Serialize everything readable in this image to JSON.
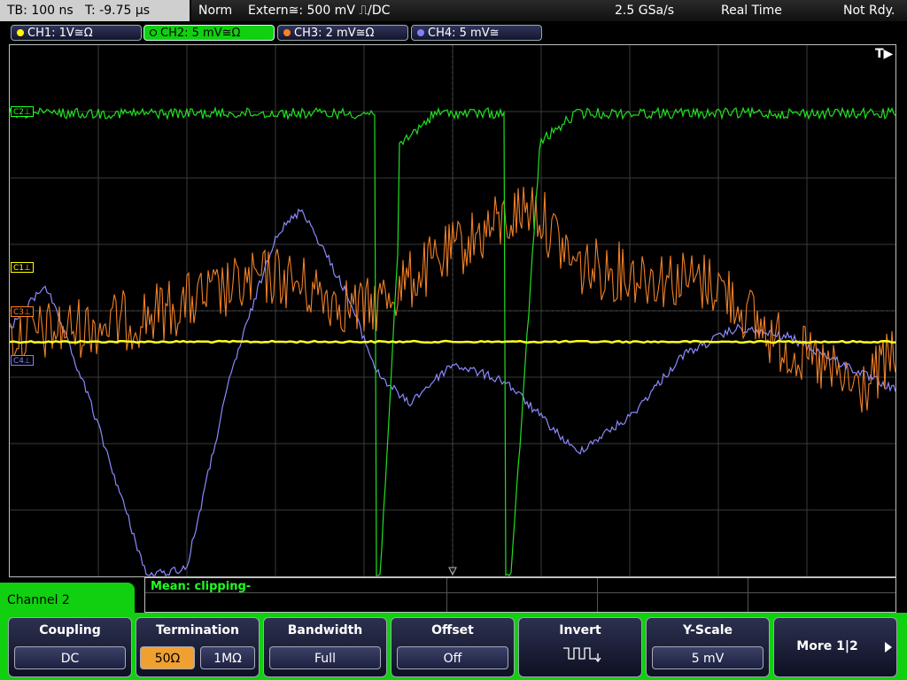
{
  "status": {
    "timebase": "TB: 100 ns",
    "trigger_time": "T: -9.75 µs",
    "acq_mode": "Norm",
    "trigger": "Extern≅: 500 mV ⎍/DC",
    "sample_rate": "2.5 GSa/s",
    "acq_type": "Real Time",
    "ready_state": "Not Rdy."
  },
  "channels": [
    {
      "label": "CH1: 1V≅Ω",
      "color": "#ffff00"
    },
    {
      "label": "CH2: 5 mV≅Ω",
      "color": "#20ff20"
    },
    {
      "label": "CH3: 2 mV≅Ω",
      "color": "#ff8020"
    },
    {
      "label": "CH4: 5 mV≅",
      "color": "#8080ff"
    }
  ],
  "markers": {
    "c1": "C1⊥",
    "c2": "C2⊥",
    "c3": "C3⊥",
    "c4": "C4⊥"
  },
  "trigger_indicator": "T▶",
  "measurement": "Mean: clipping-",
  "menu": {
    "title": "Channel 2",
    "coupling": {
      "label": "Coupling",
      "value": "DC"
    },
    "termination": {
      "label": "Termination",
      "options": [
        "50Ω",
        "1MΩ"
      ],
      "selected": "50Ω"
    },
    "bandwidth": {
      "label": "Bandwidth",
      "value": "Full"
    },
    "offset": {
      "label": "Offset",
      "value": "Off"
    },
    "invert": {
      "label": "Invert",
      "icon": "invert-waveform-icon"
    },
    "yscale": {
      "label": "Y-Scale",
      "value": "5 mV"
    },
    "more": {
      "label": "More 1|2"
    }
  }
}
